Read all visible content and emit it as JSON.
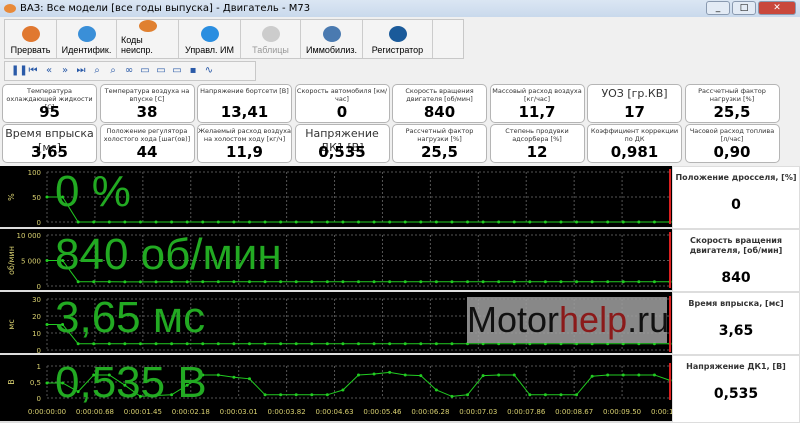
{
  "window": {
    "title": "ВАЗ: Все модели [все годы выпуска] - Двигатель - М73",
    "controls": [
      "_",
      "□",
      "✕"
    ]
  },
  "toolbar": [
    {
      "label": "Прервать",
      "icon": "abort-icon",
      "color": "#e07830",
      "disabled": false
    },
    {
      "label": "Идентифик.",
      "icon": "info-icon",
      "color": "#3a8fd8",
      "disabled": false
    },
    {
      "label": "Коды неиспр.",
      "icon": "engine-icon",
      "color": "#e08030",
      "disabled": false
    },
    {
      "label": "Управл. ИМ",
      "icon": "gear-icon",
      "color": "#2a8ee0",
      "disabled": false
    },
    {
      "label": "Таблицы",
      "icon": "table-icon",
      "color": "#cccccc",
      "disabled": true
    },
    {
      "label": "Иммобилиз.",
      "icon": "key-icon",
      "color": "#4a7ab0",
      "disabled": false
    },
    {
      "label": "Регистратор",
      "icon": "gauge-icon",
      "color": "#1a5a9a",
      "disabled": false
    }
  ],
  "playback": [
    "pause",
    "first",
    "prev",
    "next",
    "last",
    "zoom-out",
    "zoom-in",
    "link",
    "folder-new",
    "folder-up",
    "folder-open",
    "save",
    "chart"
  ],
  "gauges": [
    {
      "label": "Температура охлаждающей жидкости [C]",
      "value": "95"
    },
    {
      "label": "Температура воздуха на впуске [C]",
      "value": "38"
    },
    {
      "label": "Напряжение бортсети [В]",
      "value": "13,41"
    },
    {
      "label": "Скорость автомобиля [км/час]",
      "value": "0"
    },
    {
      "label": "Скорость вращения двигателя [об/мин]",
      "value": "840"
    },
    {
      "label": "Массовый расход воздуха [кг/час]",
      "value": "11,7"
    },
    {
      "label": "УОЗ [гр.КВ]",
      "value": "17",
      "big": true
    },
    {
      "label": "Рассчетный фактор нагрузки [%]",
      "value": "25,5"
    },
    {
      "label": "Время впрыска [мс]",
      "value": "3,65",
      "big": true
    },
    {
      "label": "Положение регулятора холостого хода [шаг(ов)]",
      "value": "44"
    },
    {
      "label": "Желаемый расход воздуха на холостом ходу [кг/ч]",
      "value": "11,9"
    },
    {
      "label": "Напряжение ДК1 [В]",
      "value": "0,535",
      "big": true
    },
    {
      "label": "Рассчетный фактор нагрузки [%]",
      "value": "25,5"
    },
    {
      "label": "Степень продувки адсорбера [%]",
      "value": "12"
    },
    {
      "label": "Коэффициент коррекции по ДК",
      "value": "0,981"
    },
    {
      "label": "Часовой расход топлива [л/час]",
      "value": "0,90"
    }
  ],
  "watermark": {
    "a": "Motor",
    "b": "help",
    ".c": "",
    "c": ".ru"
  },
  "chart_data": {
    "type": "line",
    "x_tick_labels": [
      "0:00:00:00",
      "0:00:00.68",
      "0:00:01.45",
      "0:00:02.18",
      "0:00:03.01",
      "0:00:03.82",
      "0:00:04.63",
      "0:00:05.46",
      "0:00:06.28",
      "0:00:07.03",
      "0:00:07.86",
      "0:00:08.67",
      "0:00:09.50",
      "0:00:10.31"
    ],
    "xlim": [
      0,
      10.31
    ],
    "grid": true,
    "series_color": "#22cc22",
    "cursor_color": "#dd2020",
    "charts": [
      {
        "ylabel": "%",
        "yticks": [
          "0",
          "50",
          "100"
        ],
        "ylim": [
          0,
          100
        ],
        "readout": "0 %",
        "side_title": "Положение дросселя, [%]",
        "side_value": "0",
        "values": [
          50,
          50,
          0,
          0,
          0,
          0,
          0,
          0,
          0,
          0,
          0,
          0,
          0,
          0,
          0,
          0,
          0,
          0,
          0,
          0,
          0,
          0,
          0,
          0,
          0,
          0,
          0,
          0,
          0,
          0,
          0,
          0,
          0,
          0,
          0,
          0,
          0,
          0,
          0,
          0,
          0
        ]
      },
      {
        "ylabel": "об/мин",
        "yticks": [
          "0",
          "5 000",
          "10 000"
        ],
        "ylim": [
          0,
          10000
        ],
        "readout": "840 об/мин",
        "side_title": "Скорость вращения двигателя, [об/мин]",
        "side_value": "840",
        "values": [
          5000,
          5000,
          840,
          840,
          840,
          800,
          800,
          800,
          840,
          800,
          840,
          840,
          840,
          840,
          840,
          840,
          840,
          840,
          840,
          840,
          840,
          840,
          840,
          840,
          840,
          840,
          840,
          840,
          840,
          840,
          840,
          840,
          840,
          840,
          840,
          840,
          840,
          840,
          840,
          840,
          840
        ]
      },
      {
        "ylabel": "мс",
        "yticks": [
          "0",
          "10",
          "20",
          "30"
        ],
        "ylim": [
          0,
          30
        ],
        "readout": "3,65 мс",
        "side_title": "Время впрыска, [мс]",
        "side_value": "3,65",
        "values": [
          15,
          15,
          3.65,
          3.65,
          3.65,
          3.65,
          3.65,
          3.65,
          3.65,
          3.65,
          3.65,
          3.65,
          3.65,
          3.65,
          3.65,
          3.65,
          3.65,
          3.65,
          3.65,
          3.65,
          3.65,
          3.65,
          3.65,
          3.65,
          3.65,
          3.65,
          3.65,
          3.65,
          3.65,
          3.65,
          3.65,
          3.65,
          3.65,
          3.65,
          3.65,
          3.65,
          3.65,
          3.65,
          3.65,
          3.65,
          3.65
        ]
      },
      {
        "ylabel": "В",
        "yticks": [
          "0",
          "0,5",
          "1"
        ],
        "ylim": [
          0,
          1.2
        ],
        "readout": "0,535 В",
        "side_title": "Напряжение ДК1, [В]",
        "side_value": "0,535",
        "values": [
          0.47,
          0.47,
          0.2,
          0.72,
          0.72,
          0.4,
          0.05,
          0.08,
          0.1,
          0.4,
          0.72,
          0.72,
          0.65,
          0.6,
          0.1,
          0.1,
          0.1,
          0.1,
          0.1,
          0.25,
          0.72,
          0.75,
          0.8,
          0.72,
          0.7,
          0.25,
          0.05,
          0.1,
          0.7,
          0.72,
          0.72,
          0.1,
          0.1,
          0.1,
          0.1,
          0.68,
          0.72,
          0.72,
          0.72,
          0.72,
          0.55
        ]
      }
    ]
  }
}
